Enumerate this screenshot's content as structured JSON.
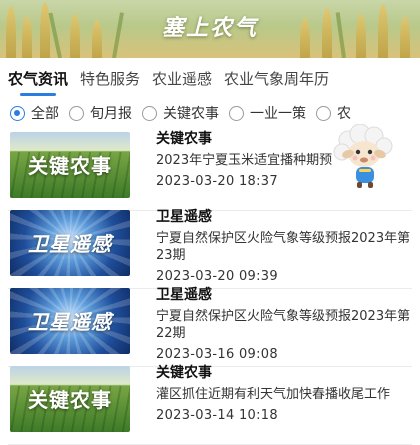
{
  "app": {
    "title": "塞上农气"
  },
  "tabs": [
    {
      "label": "农气资讯"
    },
    {
      "label": "特色服务"
    },
    {
      "label": "农业遥感"
    },
    {
      "label": "农业气象周年历"
    }
  ],
  "filters": [
    {
      "label": "全部",
      "checked": true
    },
    {
      "label": "旬月报",
      "checked": false
    },
    {
      "label": "关键农事",
      "checked": false
    },
    {
      "label": "一业一策",
      "checked": false
    },
    {
      "label": "农",
      "checked": false
    }
  ],
  "items": [
    {
      "thumb_label": "关键农事",
      "thumb_kind": "farm",
      "tag": "关键农事",
      "title": "2023年宁夏玉米适宜播种期预",
      "date": "2023-03-20 18:37"
    },
    {
      "thumb_label": "卫星遥感",
      "thumb_kind": "sat",
      "tag": "卫星遥感",
      "title": "宁夏自然保护区火险气象等级预报2023年第23期",
      "date": "2023-03-20 09:39"
    },
    {
      "thumb_label": "卫星遥感",
      "thumb_kind": "sat",
      "tag": "卫星遥感",
      "title": "宁夏自然保护区火险气象等级预报2023年第22期",
      "date": "2023-03-16 09:08"
    },
    {
      "thumb_label": "关键农事",
      "thumb_kind": "farm",
      "tag": "关键农事",
      "title": "灌区抓住近期有利天气加快春播收尾工作",
      "date": "2023-03-14 10:18"
    }
  ],
  "colors": {
    "accent": "#2a7de1"
  }
}
